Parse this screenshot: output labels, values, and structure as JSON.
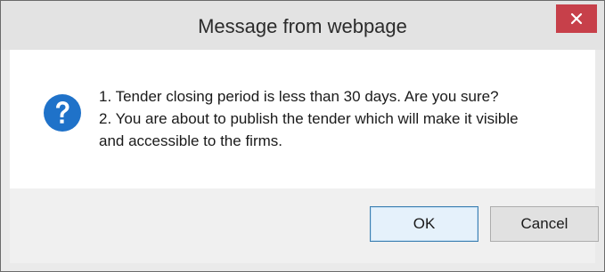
{
  "dialog": {
    "title": "Message from webpage",
    "close_icon": "close-icon",
    "message_icon": "question-icon",
    "message_lines": [
      "1. Tender closing period is less than 30 days. Are you sure?",
      "2. You are about to publish the tender which will make it visible",
      "and accessible to the firms."
    ],
    "ok_label": "OK",
    "cancel_label": "Cancel"
  },
  "colors": {
    "close_button": "#c7404a",
    "question_icon": "#1f72c9",
    "ok_border": "#3c7fb1"
  }
}
